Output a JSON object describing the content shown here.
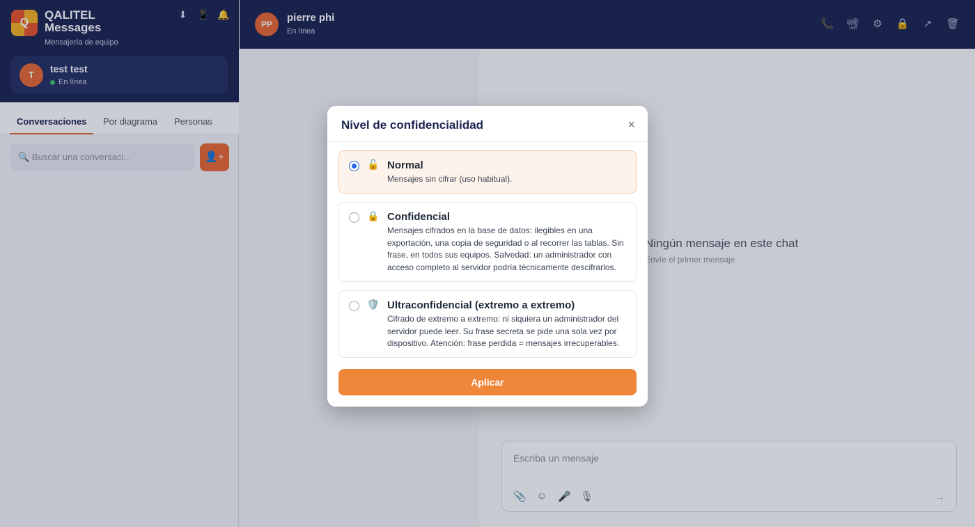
{
  "app": {
    "title": "QALITEL Messages",
    "subtitle": "Mensajería de equipo",
    "logo_letter": "Q",
    "top_icons": [
      "download-icon",
      "mobile-icon",
      "bell-icon"
    ]
  },
  "current_user": {
    "initial": "T",
    "name": "test test",
    "status": "En línea"
  },
  "tabs": [
    {
      "label": "Conversaciones",
      "active": true
    },
    {
      "label": "Por diagrama",
      "active": false
    },
    {
      "label": "Personas",
      "active": false
    }
  ],
  "search": {
    "placeholder": "🔍 Buscar una conversaci..."
  },
  "add_button": "👤+",
  "chat": {
    "initials": "PP",
    "name": "pierre phi",
    "status": "En línea",
    "header_icons": [
      "phone-icon",
      "video-icon",
      "gear-icon",
      "lock-icon",
      "share-icon",
      "trash-icon"
    ],
    "header_glyphs": [
      "📞",
      "📽",
      "⚙",
      "🔒",
      "↗",
      "🗑"
    ],
    "empty_title": "Ningún mensaje en este chat",
    "empty_sub": "Envíe el primer mensaje",
    "composer_placeholder": "Escriba un mensaje",
    "composer_tools": [
      "📎",
      "☺",
      "🎤",
      "🎙"
    ],
    "send_glyph": "→"
  },
  "modal": {
    "title": "Nivel de confidencialidad",
    "close": "×",
    "options": [
      {
        "icon": "🔓",
        "title": "Normal",
        "desc": "Mensajes sin cifrar (uso habitual).",
        "selected": true
      },
      {
        "icon": "🔒",
        "title": "Confidencial",
        "desc": "Mensajes cifrados en la base de datos: ilegibles en una exportación, una copia de seguridad o al recorrer las tablas. Sin frase, en todos sus equipos. Salvedad: un administrador con acceso completo al servidor podría técnicamente descifrarlos.",
        "selected": false
      },
      {
        "icon": "🛡️",
        "title": "Ultraconfidencial (extremo a extremo)",
        "desc": "Cifrado de extremo a extremo: ni siquiera un administrador del servidor puede leer. Su frase secreta se pide una sola vez por dispositivo. Atención: frase perdida = mensajes irrecuperables.",
        "selected": false
      }
    ],
    "apply": "Aplicar"
  }
}
